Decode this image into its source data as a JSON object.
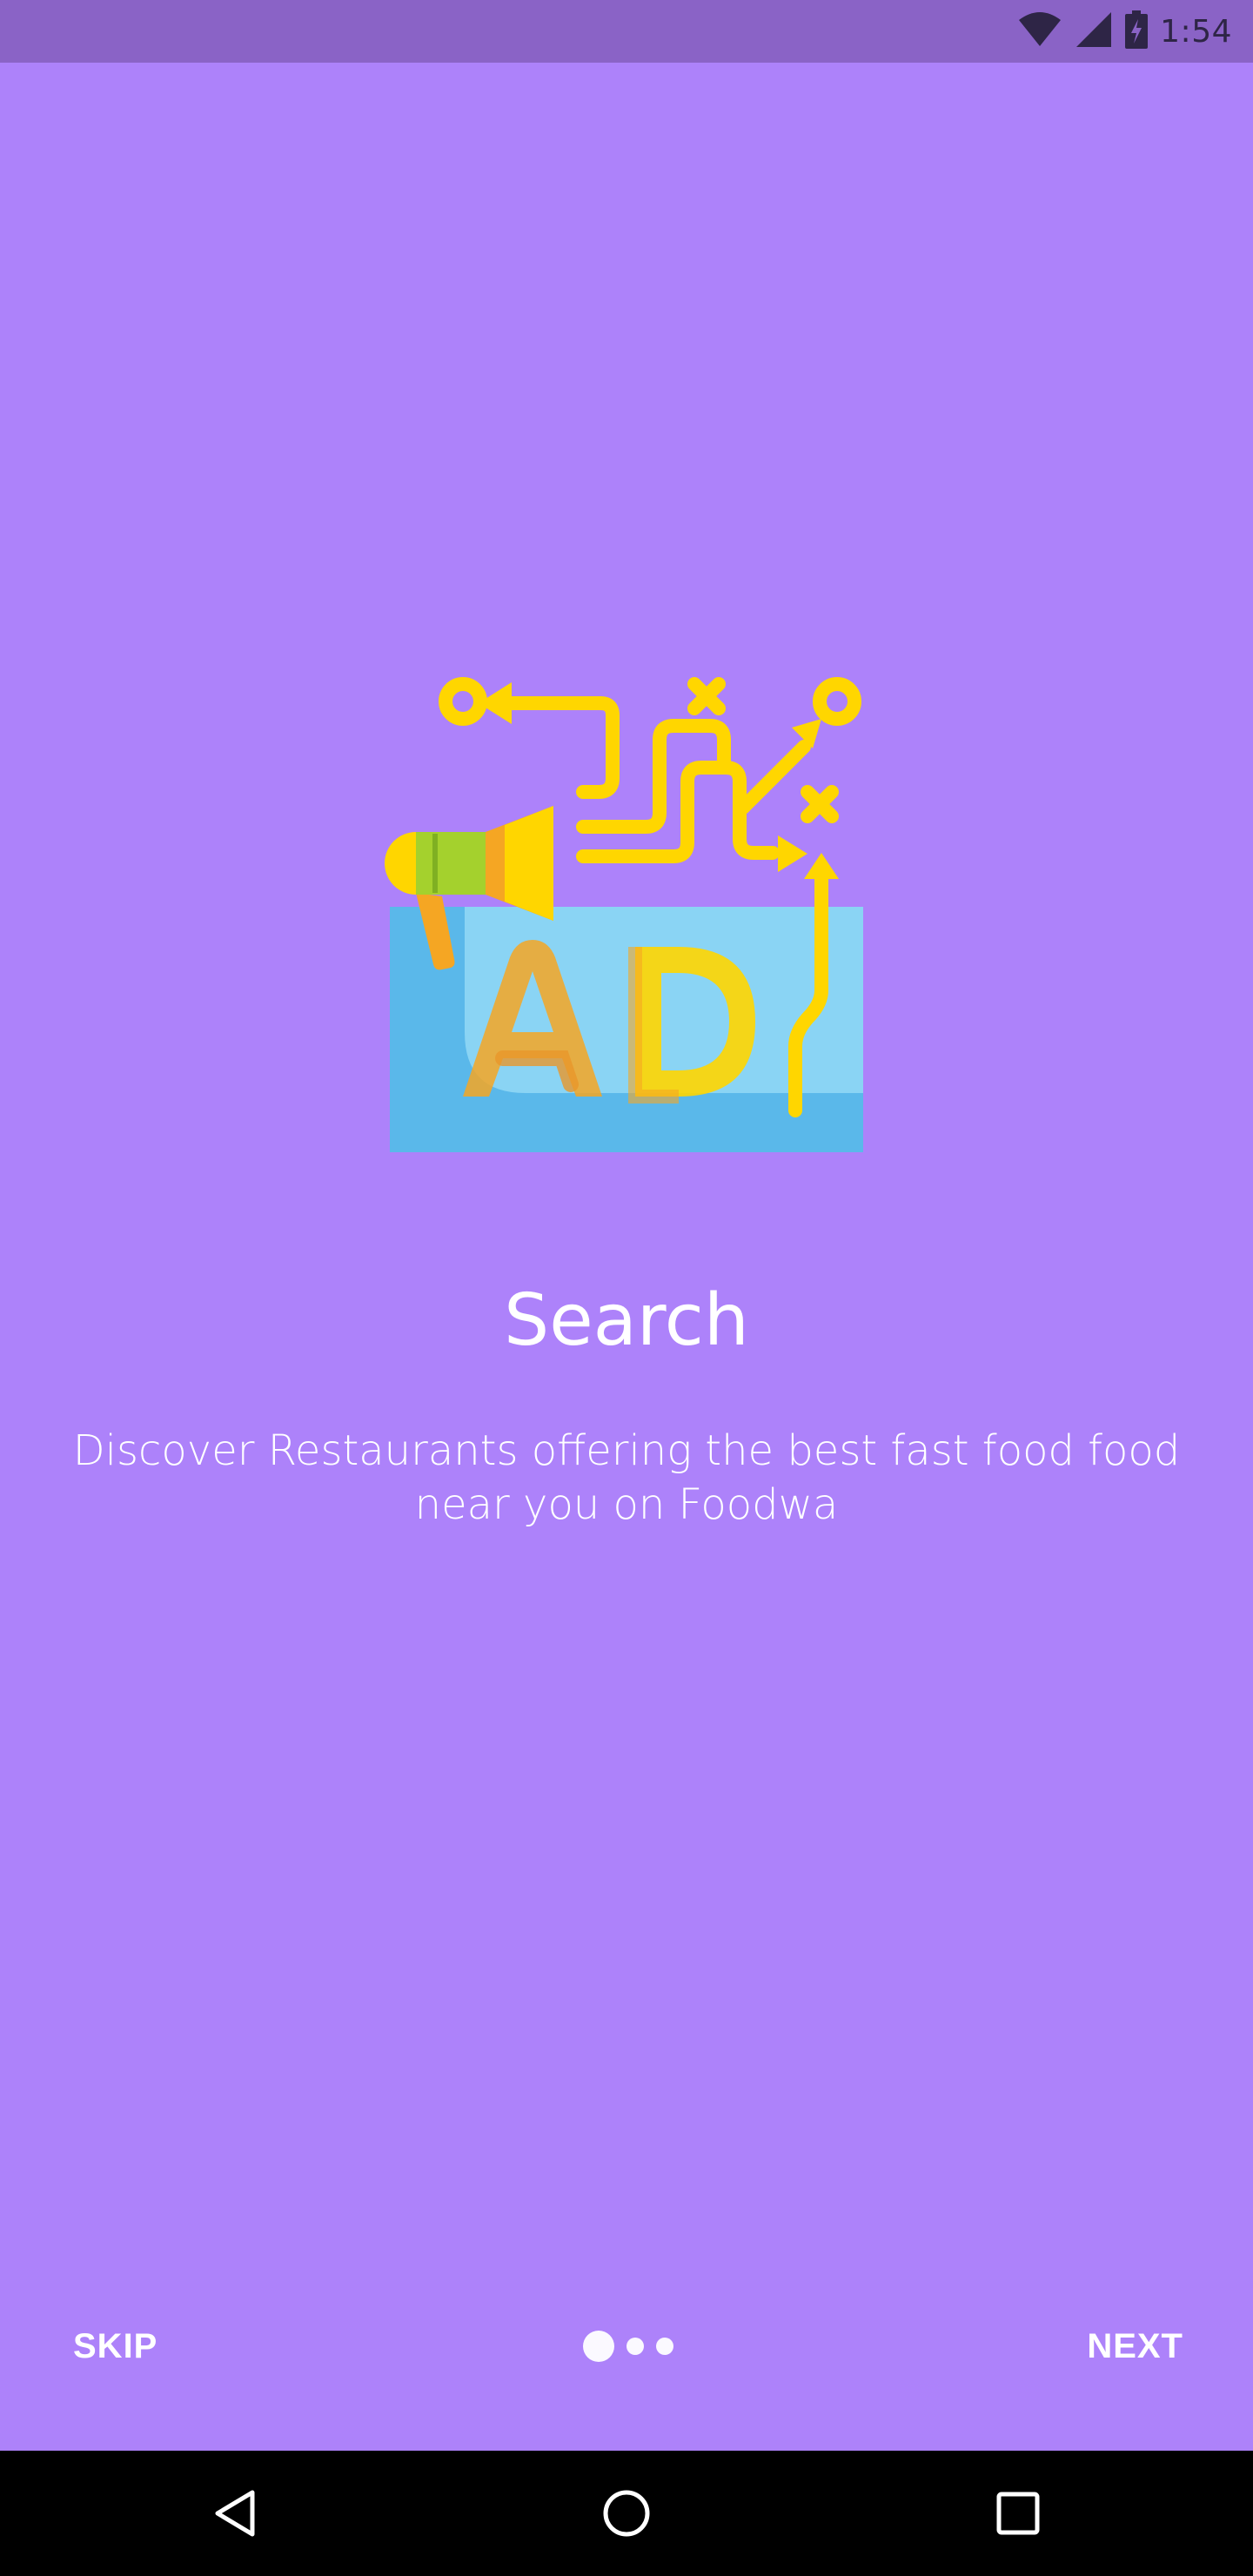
{
  "status_bar": {
    "time": "1:54",
    "icons": [
      "wifi-icon",
      "cell-signal-icon",
      "battery-charging-icon"
    ]
  },
  "onboarding": {
    "illustration_icon": "megaphone-ad-icon",
    "title": "Search",
    "description": "Discover Restaurants offering the best fast food food near you on Foodwa",
    "page_indicator": {
      "total": 3,
      "active": 1
    }
  },
  "footer": {
    "skip_label": "SKIP",
    "next_label": "NEXT"
  },
  "nav_bar": {
    "icons": [
      "back-icon",
      "home-icon",
      "recents-icon"
    ]
  },
  "colors": {
    "background": "#AD82FA",
    "status_bar": "#8A63C6",
    "text": "#FFFFFF",
    "accent_yellow": "#FFD600",
    "accent_blue": "#5AB8EA"
  }
}
